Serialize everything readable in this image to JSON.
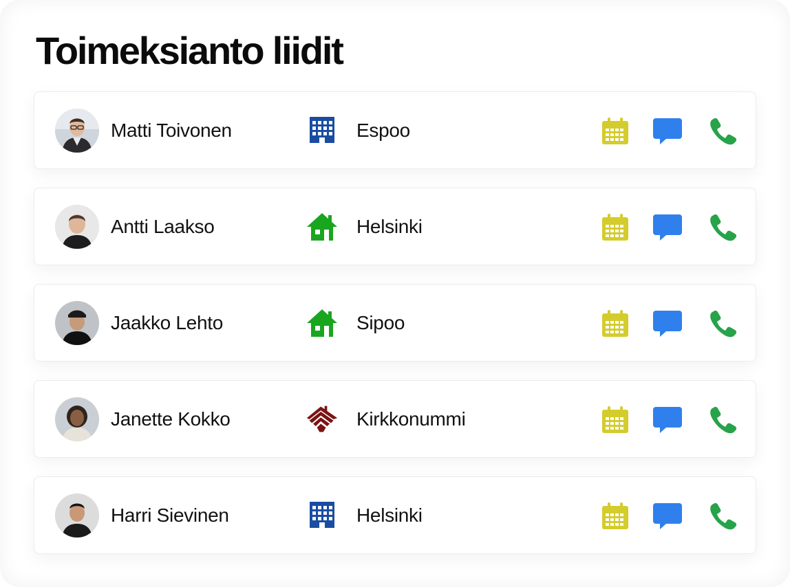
{
  "title": "Toimeksianto liidit",
  "colors": {
    "calendar": "#d4cc2c",
    "message": "#2f80ed",
    "phone": "#27a34a",
    "building": "#1a4da1",
    "house": "#1aa51f",
    "roof": "#7a1414"
  },
  "leads": [
    {
      "name": "Matti Toivonen",
      "location_icon": "building-icon",
      "city": "Espoo"
    },
    {
      "name": "Antti Laakso",
      "location_icon": "house-icon",
      "city": "Helsinki"
    },
    {
      "name": "Jaakko Lehto",
      "location_icon": "house-icon",
      "city": "Sipoo"
    },
    {
      "name": "Janette Kokko",
      "location_icon": "farmhouse-icon",
      "city": "Kirkkonummi"
    },
    {
      "name": "Harri Sievinen",
      "location_icon": "building-icon",
      "city": "Helsinki"
    }
  ],
  "actions": [
    "calendar-icon",
    "message-icon",
    "phone-icon"
  ]
}
